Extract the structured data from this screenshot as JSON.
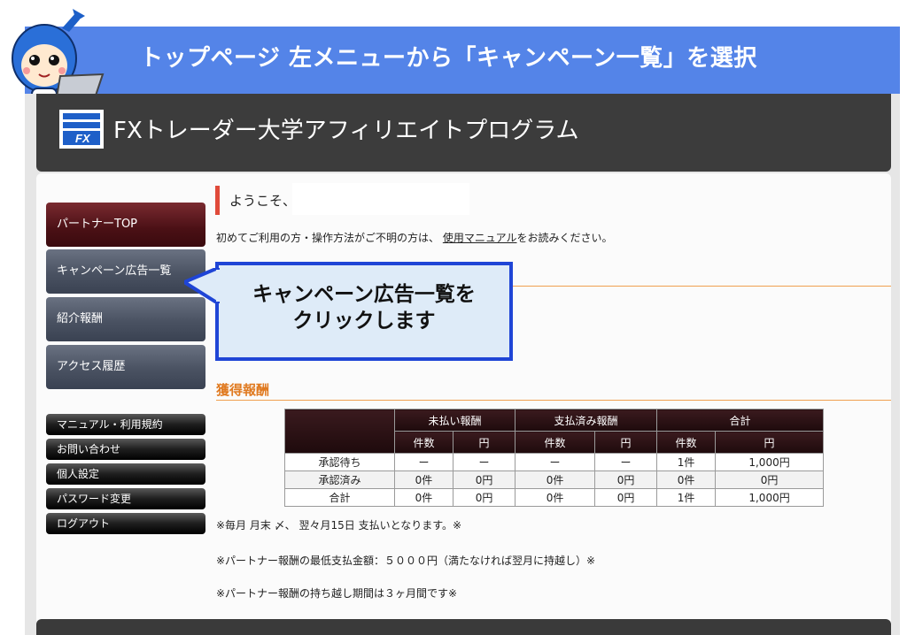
{
  "banner": {
    "title": "トップページ 左メニューから「キャンペーン一覧」を選択"
  },
  "app": {
    "title": "FXトレーダー大学アフィリエイトプログラム",
    "logo_text": "FX"
  },
  "sidebar": {
    "main_items": [
      {
        "label": "パートナーTOP"
      },
      {
        "label": "キャンペーン広告一覧"
      },
      {
        "label": "紹介報酬"
      },
      {
        "label": "アクセス履歴"
      }
    ],
    "sub_items": [
      {
        "label": "マニュアル・利用規約"
      },
      {
        "label": "お問い合わせ"
      },
      {
        "label": "個人設定"
      },
      {
        "label": "パスワード変更"
      },
      {
        "label": "ログアウト"
      }
    ]
  },
  "welcome": {
    "greeting": "ようこそ、",
    "intro_before": "初めてご利用の方・操作方法がご不明の方は、",
    "intro_link": "使用マニュアル",
    "intro_after": "をお読みください。"
  },
  "callout": {
    "line1": "キャンペーン広告一覧を",
    "line2": "クリックします"
  },
  "rewards": {
    "section_title": "獲得報酬",
    "groups": [
      "未払い報酬",
      "支払済み報酬",
      "合計"
    ],
    "subheaders": [
      "件数",
      "円",
      "件数",
      "円",
      "件数",
      "円"
    ],
    "rows": [
      {
        "label": "承認待ち",
        "cells": [
          "ー",
          "ー",
          "ー",
          "ー",
          "1件",
          "1,000円"
        ]
      },
      {
        "label": "承認済み",
        "cells": [
          "0件",
          "0円",
          "0件",
          "0円",
          "0件",
          "0円"
        ]
      },
      {
        "label": "合計",
        "cells": [
          "0件",
          "0円",
          "0件",
          "0円",
          "1件",
          "1,000円"
        ]
      }
    ]
  },
  "notes": [
    "※毎月 月末 〆、 翌々月15日 支払いとなります。※",
    "※パートナー報酬の最低支払金額：５０００円（満たなければ翌月に持越し）※",
    "※パートナー報酬の持ち越し期間は３ヶ月間です※"
  ],
  "colors": {
    "banner": "#5484e8",
    "header": "#3c3c3c",
    "accent_orange": "#e07a20",
    "callout_border": "#1f45d6",
    "callout_fill": "#deebf8"
  }
}
